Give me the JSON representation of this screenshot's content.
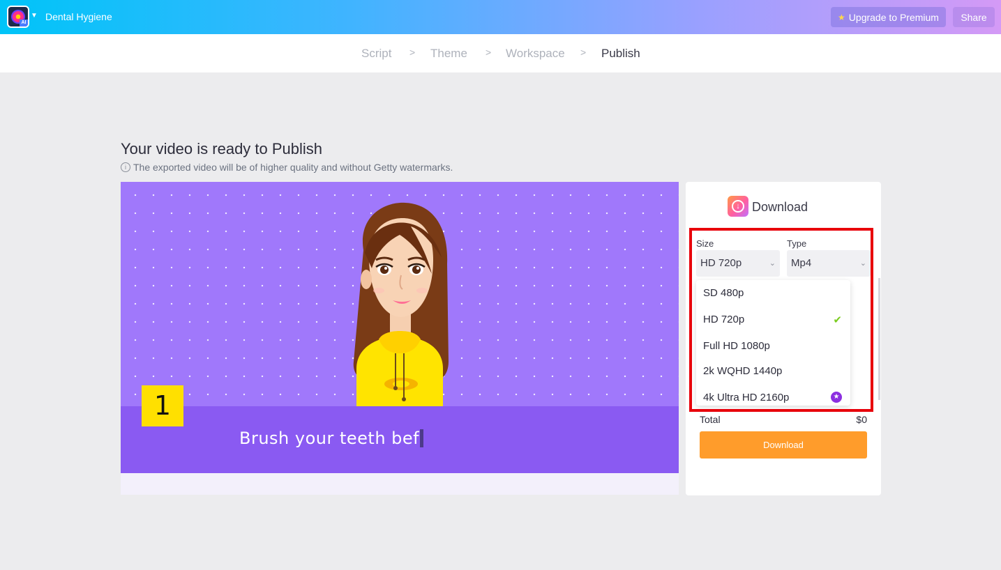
{
  "app": {
    "project_title": "Dental Hygiene",
    "logo_badge": "AI",
    "upgrade_label": "Upgrade to Premium",
    "share_label": "Share"
  },
  "steps": [
    {
      "label": "Script",
      "active": false
    },
    {
      "label": "Theme",
      "active": false
    },
    {
      "label": "Workspace",
      "active": false
    },
    {
      "label": "Publish",
      "active": true
    }
  ],
  "page": {
    "title": "Your video is ready to Publish",
    "info": "The exported video will be of higher quality and without Getty watermarks."
  },
  "preview": {
    "scene_number": "1",
    "caption": "Brush your teeth bef"
  },
  "download_panel": {
    "title": "Download",
    "size_label": "Size",
    "size_value": "HD 720p",
    "type_label": "Type",
    "type_value": "Mp4",
    "total_label": "Total",
    "total_value": "$0",
    "button_label": "Download"
  },
  "size_options": [
    {
      "label": "SD 480p",
      "selected": false,
      "premium": false
    },
    {
      "label": "HD 720p",
      "selected": true,
      "premium": false
    },
    {
      "label": "Full HD 1080p",
      "selected": false,
      "premium": false
    },
    {
      "label": "2k WQHD 1440p",
      "selected": false,
      "premium": false
    },
    {
      "label": "4k Ultra HD 2160p",
      "selected": false,
      "premium": true
    }
  ],
  "colors": {
    "accent_orange": "#ff9c2b",
    "highlight_red": "#e8000b",
    "scene_purple": "#a078fb",
    "check_green": "#7acc1f",
    "premium_purple": "#8c2fe0"
  }
}
